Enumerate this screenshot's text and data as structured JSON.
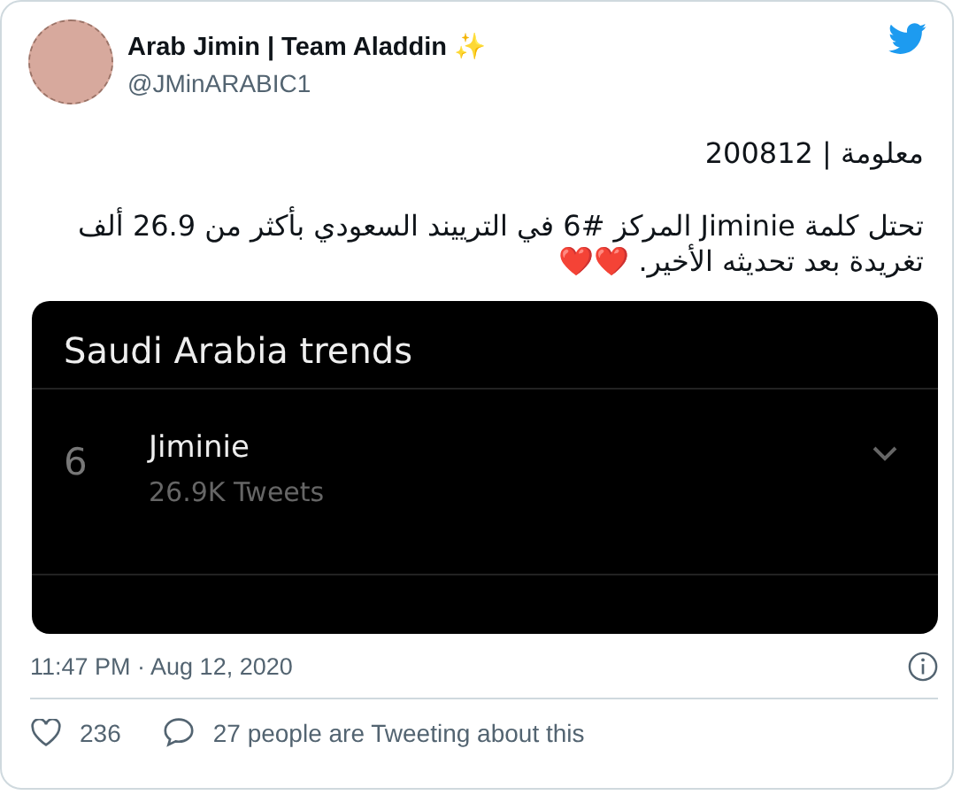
{
  "author": {
    "name": "Arab Jimin | Team Aladdin ✨",
    "handle": "@JMinARABIC1"
  },
  "text": [
    "معلومة | 200812",
    "تحتل كلمة Jiminie المركز #6 في الترييند السعودي بأكثر من 26.9 ألف تغريدة بعد تحديثه الأخير. ❤️❤️"
  ],
  "embedded_screenshot": {
    "title": "Saudi Arabia trends",
    "trends": [
      {
        "rank": "6",
        "name": "Jiminie",
        "count": "26.9K Tweets"
      }
    ]
  },
  "timestamp": "11:47 PM · Aug 12, 2020",
  "footer": {
    "likes": "236",
    "conversation": "27 people are Tweeting about this"
  }
}
